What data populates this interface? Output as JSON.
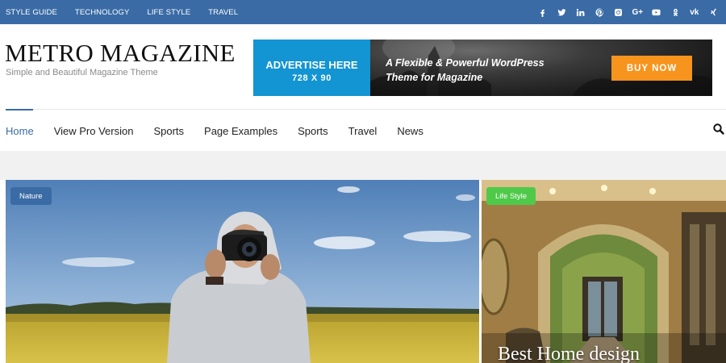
{
  "top_nav": {
    "items": [
      "STYLE GUIDE",
      "TECHNOLOGY",
      "LIFE STYLE",
      "TRAVEL"
    ]
  },
  "social_icons": [
    "facebook-icon",
    "twitter-icon",
    "linkedin-icon",
    "pinterest-icon",
    "instagram-icon",
    "google-plus-icon",
    "youtube-icon",
    "odnoklassniki-icon",
    "vk-icon",
    "xing-icon"
  ],
  "social_labels": {
    "google_plus": "G+",
    "vk": "vk"
  },
  "site": {
    "title": "METRO MAGAZINE",
    "tagline": "Simple and Beautiful Magazine Theme"
  },
  "ad": {
    "headline": "ADVERTISE HERE",
    "size": "728 X 90",
    "text_line1": "A Flexible & Powerful WordPress",
    "text_line2": "Theme for Magazine",
    "cta": "BUY NOW"
  },
  "main_nav": {
    "items": [
      "Home",
      "View Pro Version",
      "Sports",
      "Page Examples",
      "Sports",
      "Travel",
      "News"
    ],
    "active": "Home"
  },
  "featured": [
    {
      "category": "Nature",
      "title": ""
    },
    {
      "category": "Life Style",
      "title": "Best Home design"
    }
  ],
  "colors": {
    "top_bar": "#3a6ba5",
    "accent": "#3a6ba5",
    "ad_blue": "#1394d3",
    "cta_orange": "#f7941d",
    "nature_badge": "#3a6ba5",
    "lifestyle_badge": "#4fc94a",
    "gray_band": "#f1f1f1"
  }
}
